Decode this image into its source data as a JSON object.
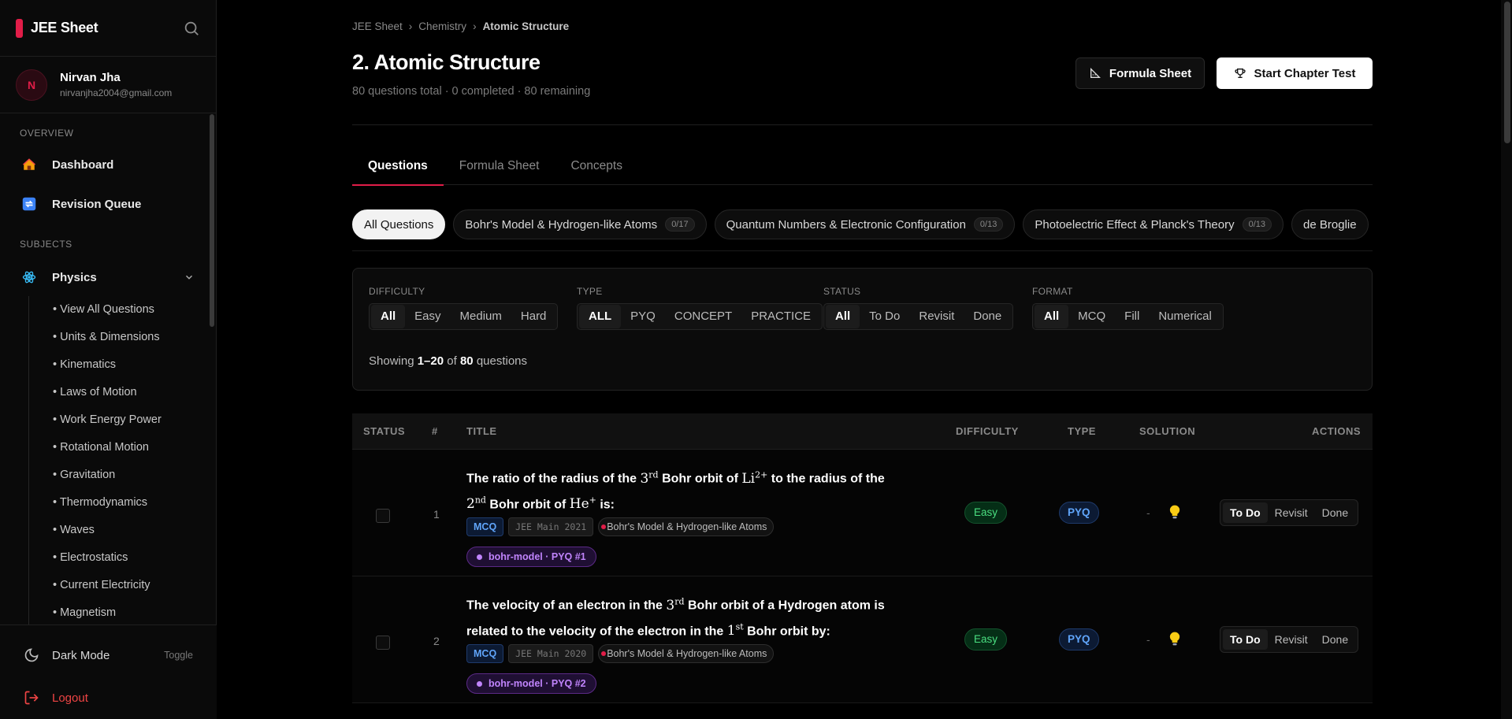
{
  "sidebar": {
    "brand": "JEE Sheet",
    "user": {
      "initial": "N",
      "name": "Nirvan Jha",
      "email": "nirvanjha2004@gmail.com"
    },
    "overview_label": "OVERVIEW",
    "overview_items": [
      {
        "label": "Dashboard",
        "icon": "house-icon"
      },
      {
        "label": "Revision Queue",
        "icon": "repeat-icon"
      }
    ],
    "subjects_label": "SUBJECTS",
    "subject": {
      "label": "Physics",
      "icon": "atom-icon"
    },
    "sub_items": [
      "• View All Questions",
      "• Units & Dimensions",
      "• Kinematics",
      "• Laws of Motion",
      "• Work Energy Power",
      "• Rotational Motion",
      "• Gravitation",
      "• Thermodynamics",
      "• Waves",
      "• Electrostatics",
      "• Current Electricity",
      "• Magnetism"
    ],
    "dark_mode": {
      "label": "Dark Mode",
      "toggle": "Toggle"
    },
    "logout": "Logout"
  },
  "breadcrumb": {
    "items": [
      "JEE Sheet",
      "Chemistry"
    ],
    "current": "Atomic Structure",
    "sep": "›"
  },
  "page": {
    "title": "2. Atomic Structure",
    "subtitle": "80 questions total · 0 completed · 80 remaining",
    "formula_btn": "Formula Sheet",
    "test_btn": "Start Chapter Test"
  },
  "tabs": [
    "Questions",
    "Formula Sheet",
    "Concepts"
  ],
  "chips": [
    {
      "label": "All Questions",
      "count": ""
    },
    {
      "label": "Bohr's Model & Hydrogen-like Atoms",
      "count": "0/17"
    },
    {
      "label": "Quantum Numbers & Electronic Configuration",
      "count": "0/13"
    },
    {
      "label": "Photoelectric Effect & Planck's Theory",
      "count": "0/13"
    },
    {
      "label": "de Broglie",
      "count": ""
    }
  ],
  "filters": {
    "difficulty": {
      "label": "DIFFICULTY",
      "options": [
        "All",
        "Easy",
        "Medium",
        "Hard"
      ]
    },
    "type": {
      "label": "TYPE",
      "options": [
        "ALL",
        "PYQ",
        "CONCEPT",
        "PRACTICE"
      ]
    },
    "status": {
      "label": "STATUS",
      "options": [
        "All",
        "To Do",
        "Revisit",
        "Done"
      ]
    },
    "format": {
      "label": "FORMAT",
      "options": [
        "All",
        "MCQ",
        "Fill",
        "Numerical"
      ]
    },
    "showing_prefix": "Showing",
    "showing_range": "1–20",
    "showing_of": "of",
    "showing_total": "80",
    "showing_suffix": "questions"
  },
  "table": {
    "headers": {
      "status": "STATUS",
      "num": "#",
      "title": "TITLE",
      "difficulty": "DIFFICULTY",
      "type": "TYPE",
      "solution": "SOLUTION",
      "actions": "ACTIONS"
    },
    "rows": [
      {
        "num": "1",
        "format": "MCQ",
        "exam": "JEE Main 2021",
        "topic": "Bohr's Model & Hydrogen-like Atoms",
        "pyq": "bohr-model · PYQ #1",
        "difficulty": "Easy",
        "type": "PYQ",
        "solution": "-",
        "actions": [
          "To Do",
          "Revisit",
          "Done"
        ]
      },
      {
        "num": "2",
        "format": "MCQ",
        "exam": "JEE Main 2020",
        "topic": "Bohr's Model & Hydrogen-like Atoms",
        "pyq": "bohr-model · PYQ #2",
        "difficulty": "Easy",
        "type": "PYQ",
        "solution": "-",
        "actions": [
          "To Do",
          "Revisit",
          "Done"
        ]
      }
    ],
    "q1": {
      "a": "The ratio of the radius of the",
      "b": "3",
      "bs": "rd",
      "c": "Bohr orbit of",
      "d": "Li",
      "ds": "2+",
      "e": "to the radius of the",
      "f": "2",
      "fs": "nd",
      "g": "Bohr orbit of",
      "h": "He",
      "hs": "+",
      "i": "is:"
    },
    "q2": {
      "a": "The velocity of an electron in the",
      "b": "3",
      "bs": "rd",
      "c": "Bohr orbit of a Hydrogen atom is related to the velocity of the electron in the",
      "d": "1",
      "ds": "st",
      "e": "Bohr orbit by:"
    }
  },
  "colors": {
    "accent": "#e11d48",
    "easy": "#4ade80",
    "pyq": "#60a5fa",
    "tag_purple": "#c084fc"
  }
}
